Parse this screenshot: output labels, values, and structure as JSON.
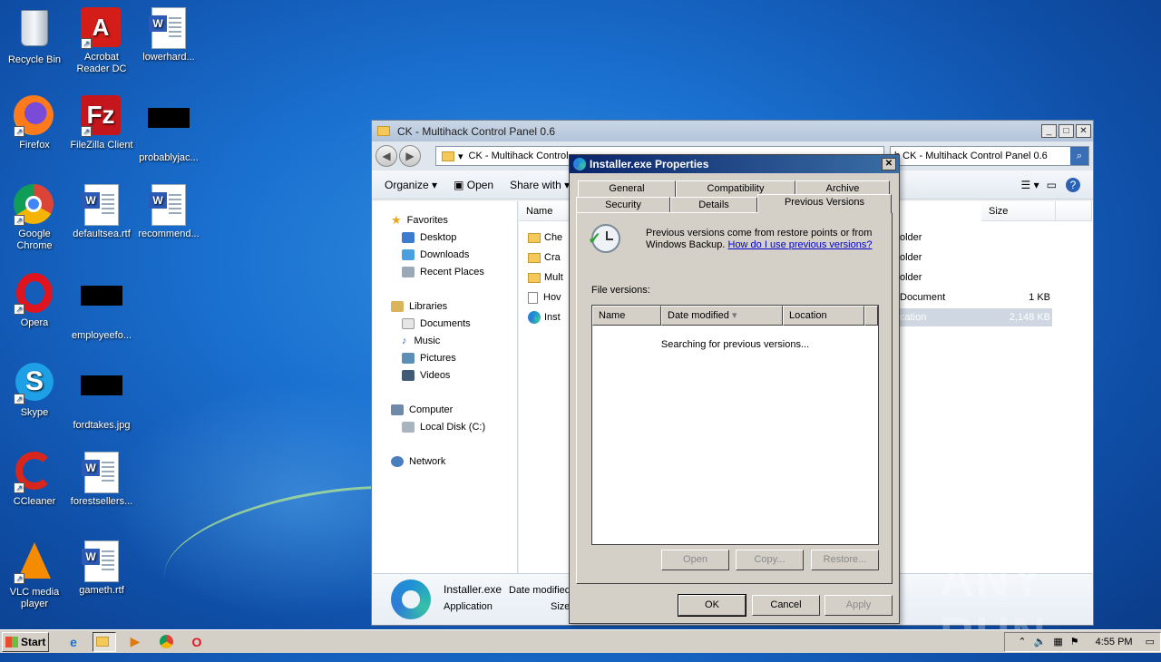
{
  "desktop": {
    "icons": [
      {
        "label": "Recycle Bin"
      },
      {
        "label": "Acrobat Reader DC"
      },
      {
        "label": "lowerhard..."
      },
      {
        "label": "Firefox"
      },
      {
        "label": "FileZilla Client"
      },
      {
        "label": "probablyjac..."
      },
      {
        "label": "Google Chrome"
      },
      {
        "label": "defaultsea.rtf"
      },
      {
        "label": "recommend..."
      },
      {
        "label": "Opera"
      },
      {
        "label": "employeefo..."
      },
      {
        "label": "Skype"
      },
      {
        "label": "fordtakes.jpg"
      },
      {
        "label": "CCleaner"
      },
      {
        "label": "forestsellers..."
      },
      {
        "label": "VLC media player"
      },
      {
        "label": "gameth.rtf"
      }
    ]
  },
  "explorer": {
    "title": "CK - Multihack Control Panel 0.6",
    "address": "CK - Multihack Control",
    "search_placeholder": "h CK - Multihack Control Panel 0.6",
    "commands": {
      "organize": "Organize",
      "open": "Open",
      "share": "Share with"
    },
    "nav": {
      "favorites": "Favorites",
      "desktop": "Desktop",
      "downloads": "Downloads",
      "recent": "Recent Places",
      "libraries": "Libraries",
      "documents": "Documents",
      "music": "Music",
      "pictures": "Pictures",
      "videos": "Videos",
      "computer": "Computer",
      "local_disk": "Local Disk (C:)",
      "network": "Network"
    },
    "columns": {
      "name": "Name",
      "size": "Size"
    },
    "rows": [
      {
        "name": "Che",
        "type": "older",
        "size": ""
      },
      {
        "name": "Cra",
        "type": "older",
        "size": ""
      },
      {
        "name": "Mult",
        "type": "older",
        "size": ""
      },
      {
        "name": "Hov",
        "type": "Document",
        "size": "1 KB"
      },
      {
        "name": "Inst",
        "type": "cation",
        "size": "2,148 KB"
      }
    ],
    "details": {
      "name": "Installer.exe",
      "date_label": "Date modified",
      "type": "Application",
      "size_label": "Size"
    }
  },
  "dialog": {
    "title": "Installer.exe Properties",
    "tabs_row1": [
      "General",
      "Compatibility",
      "Archive"
    ],
    "tabs_row2": [
      "Security",
      "Details",
      "Previous Versions"
    ],
    "info_line1": "Previous versions come from restore points or from",
    "info_line2": "Windows Backup.",
    "info_link": "How do I use previous versions?",
    "file_versions_label": "File versions:",
    "list_headers": {
      "name": "Name",
      "date": "Date modified",
      "location": "Location"
    },
    "searching": "Searching for previous versions...",
    "buttons": {
      "open": "Open",
      "copy": "Copy...",
      "restore": "Restore...",
      "ok": "OK",
      "cancel": "Cancel",
      "apply": "Apply"
    }
  },
  "taskbar": {
    "start": "Start",
    "clock": "4:55 PM"
  },
  "watermark": "ANY RUN"
}
